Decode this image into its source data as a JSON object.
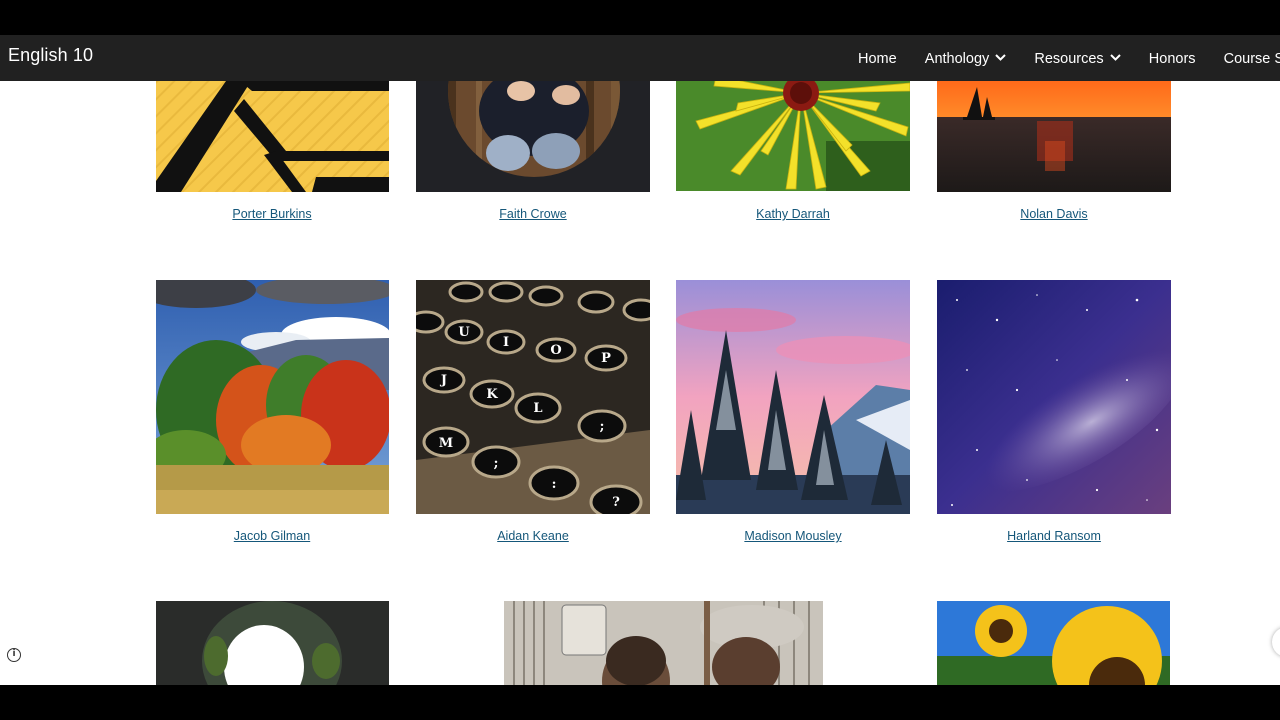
{
  "site": {
    "title": "English 10"
  },
  "nav": {
    "items": [
      {
        "label": "Home"
      },
      {
        "label": "Anthology",
        "dropdown": true
      },
      {
        "label": "Resources",
        "dropdown": true
      },
      {
        "label": "Honors"
      },
      {
        "label": "Course Syllabu"
      }
    ]
  },
  "grid": {
    "row1": [
      {
        "name": "Porter Burkins",
        "image": "yellow-black-geometric"
      },
      {
        "name": "Faith Crowe",
        "image": "portrait-circle"
      },
      {
        "name": "Kathy Darrah",
        "image": "yellow-flower"
      },
      {
        "name": "Nolan Davis",
        "image": "sunset-sailboat"
      }
    ],
    "row2": [
      {
        "name": "Jacob Gilman",
        "image": "autumn-trees"
      },
      {
        "name": "Aidan Keane",
        "image": "typewriter-keys"
      },
      {
        "name": "Madison Mousley",
        "image": "pink-sky-pine-trees"
      },
      {
        "name": "Harland Ransom",
        "image": "galaxy-night-sky"
      }
    ],
    "row3": [
      {
        "image": "tunnel"
      },
      {
        "image": "two-people-photo"
      },
      {
        "image": "sunflowers"
      }
    ]
  },
  "colors": {
    "navbar": "#212121",
    "link": "#15577a",
    "background": "#ffffff"
  }
}
